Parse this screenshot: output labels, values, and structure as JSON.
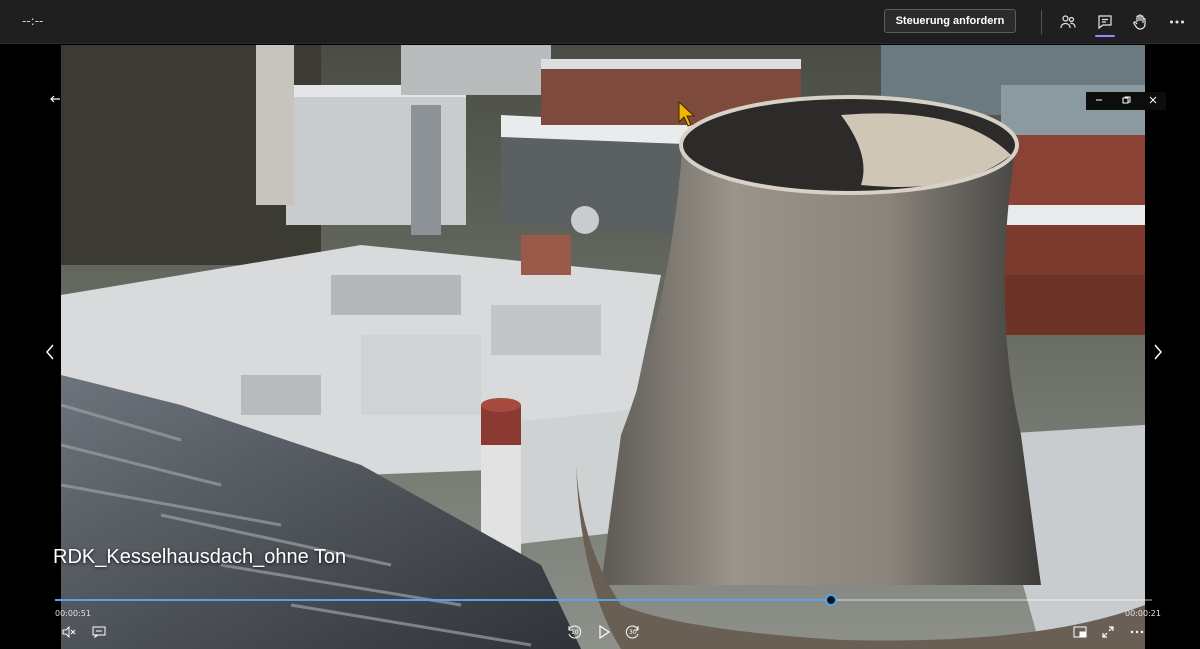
{
  "topbar": {
    "timer": "--:--",
    "request_control_label": "Steuerung anfordern",
    "icons": [
      "people-icon",
      "chat-icon",
      "raise-hand-icon",
      "more-icon"
    ]
  },
  "window_controls": [
    "minimize-icon",
    "restore-icon",
    "close-icon"
  ],
  "video": {
    "title": "RDK_Kesselhausdach_ohne Ton",
    "elapsed": "00:00:51",
    "remaining": "00:00:21",
    "progress": 0.707,
    "skip_back_seconds": "10",
    "skip_forward_seconds": "30"
  },
  "colors": {
    "accent": "#5aa2e6",
    "chat_indicator": "#8b8cff",
    "cursor": "#f5b400"
  }
}
